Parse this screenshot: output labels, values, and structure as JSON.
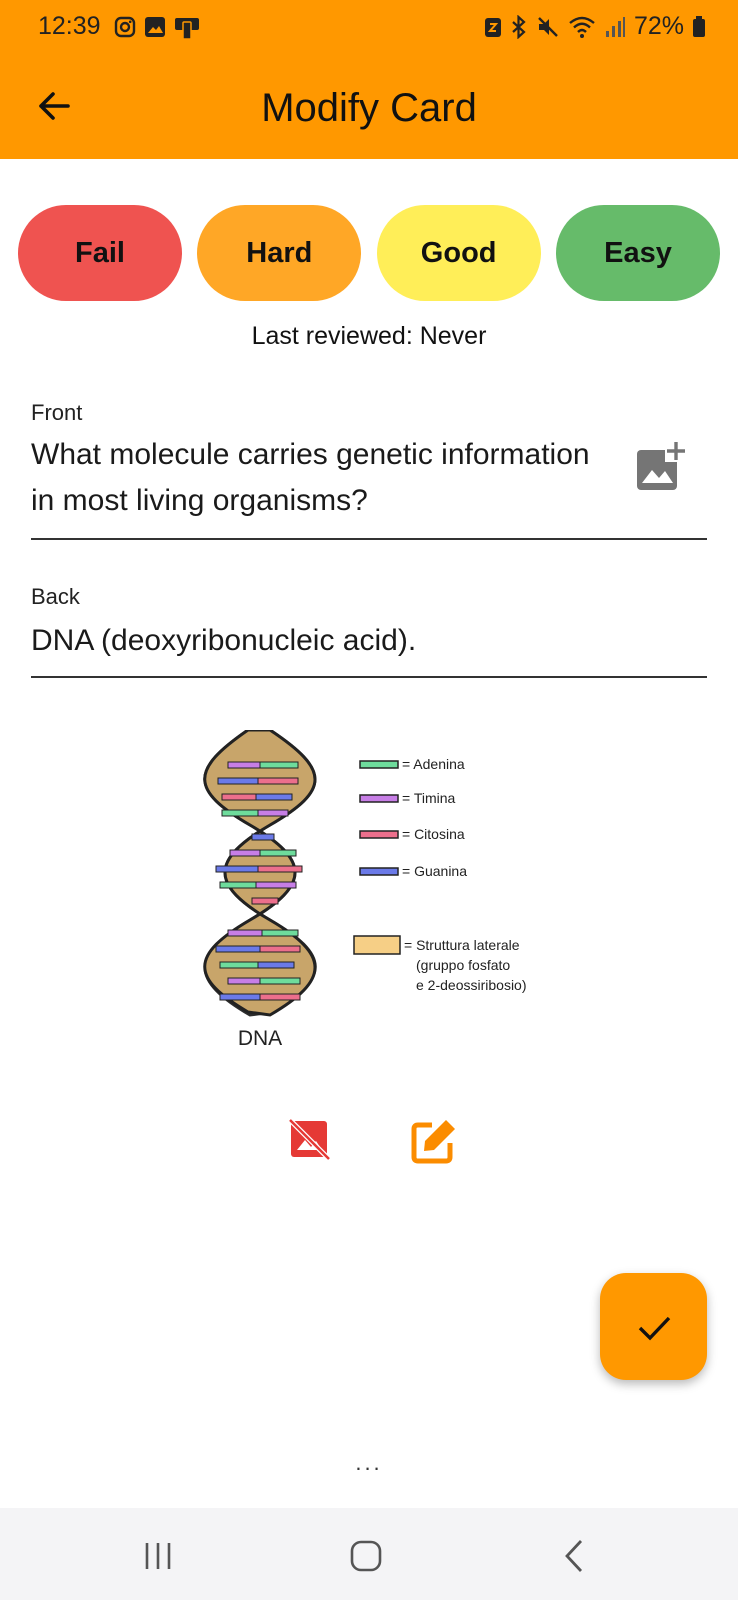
{
  "status_bar": {
    "time": "12:39",
    "battery": "72%",
    "left_icons": [
      "instagram-icon",
      "gallery-icon",
      "device-icon"
    ],
    "right_icons": [
      "nfc-icon",
      "bluetooth-icon",
      "mute-icon",
      "wifi-icon",
      "signal-icon",
      "battery-icon"
    ]
  },
  "app_bar": {
    "title": "Modify Card",
    "back_icon": "arrow-back-icon",
    "color": "#ff9800"
  },
  "rating": {
    "buttons": [
      {
        "label": "Fail",
        "color": "#ef5350"
      },
      {
        "label": "Hard",
        "color": "#ffa726"
      },
      {
        "label": "Good",
        "color": "#ffee58"
      },
      {
        "label": "Easy",
        "color": "#66bb6a"
      }
    ],
    "last_reviewed": "Last reviewed: Never"
  },
  "card": {
    "front_label": "Front",
    "front_value": "What molecule carries genetic information in most living organisms?",
    "back_label": "Back",
    "back_value": "DNA (deoxyribonucleic acid).",
    "add_image_icon": "add-photo-icon"
  },
  "image": {
    "caption": "DNA",
    "legend": [
      {
        "label": "= Adenina",
        "color": "#6edc9c"
      },
      {
        "label": "= Timina",
        "color": "#c77ee6"
      },
      {
        "label": "= Citosina",
        "color": "#ec6f8c"
      },
      {
        "label": "= Guanina",
        "color": "#6b7ae8"
      }
    ],
    "backbone_label_1": "= Struttura laterale",
    "backbone_label_2": "(gruppo fosfato",
    "backbone_label_3": "e 2-deossiribosio)",
    "backbone_color": "#f6cf86",
    "remove_icon": "hide-image-icon",
    "edit_icon": "edit-icon",
    "remove_color": "#e53935",
    "edit_color": "#fb8c00"
  },
  "fab": {
    "icon": "check-icon"
  },
  "footer": {
    "ellipsis": "..."
  },
  "nav_bar": {
    "items": [
      "recents-icon",
      "home-icon",
      "back-icon"
    ]
  }
}
